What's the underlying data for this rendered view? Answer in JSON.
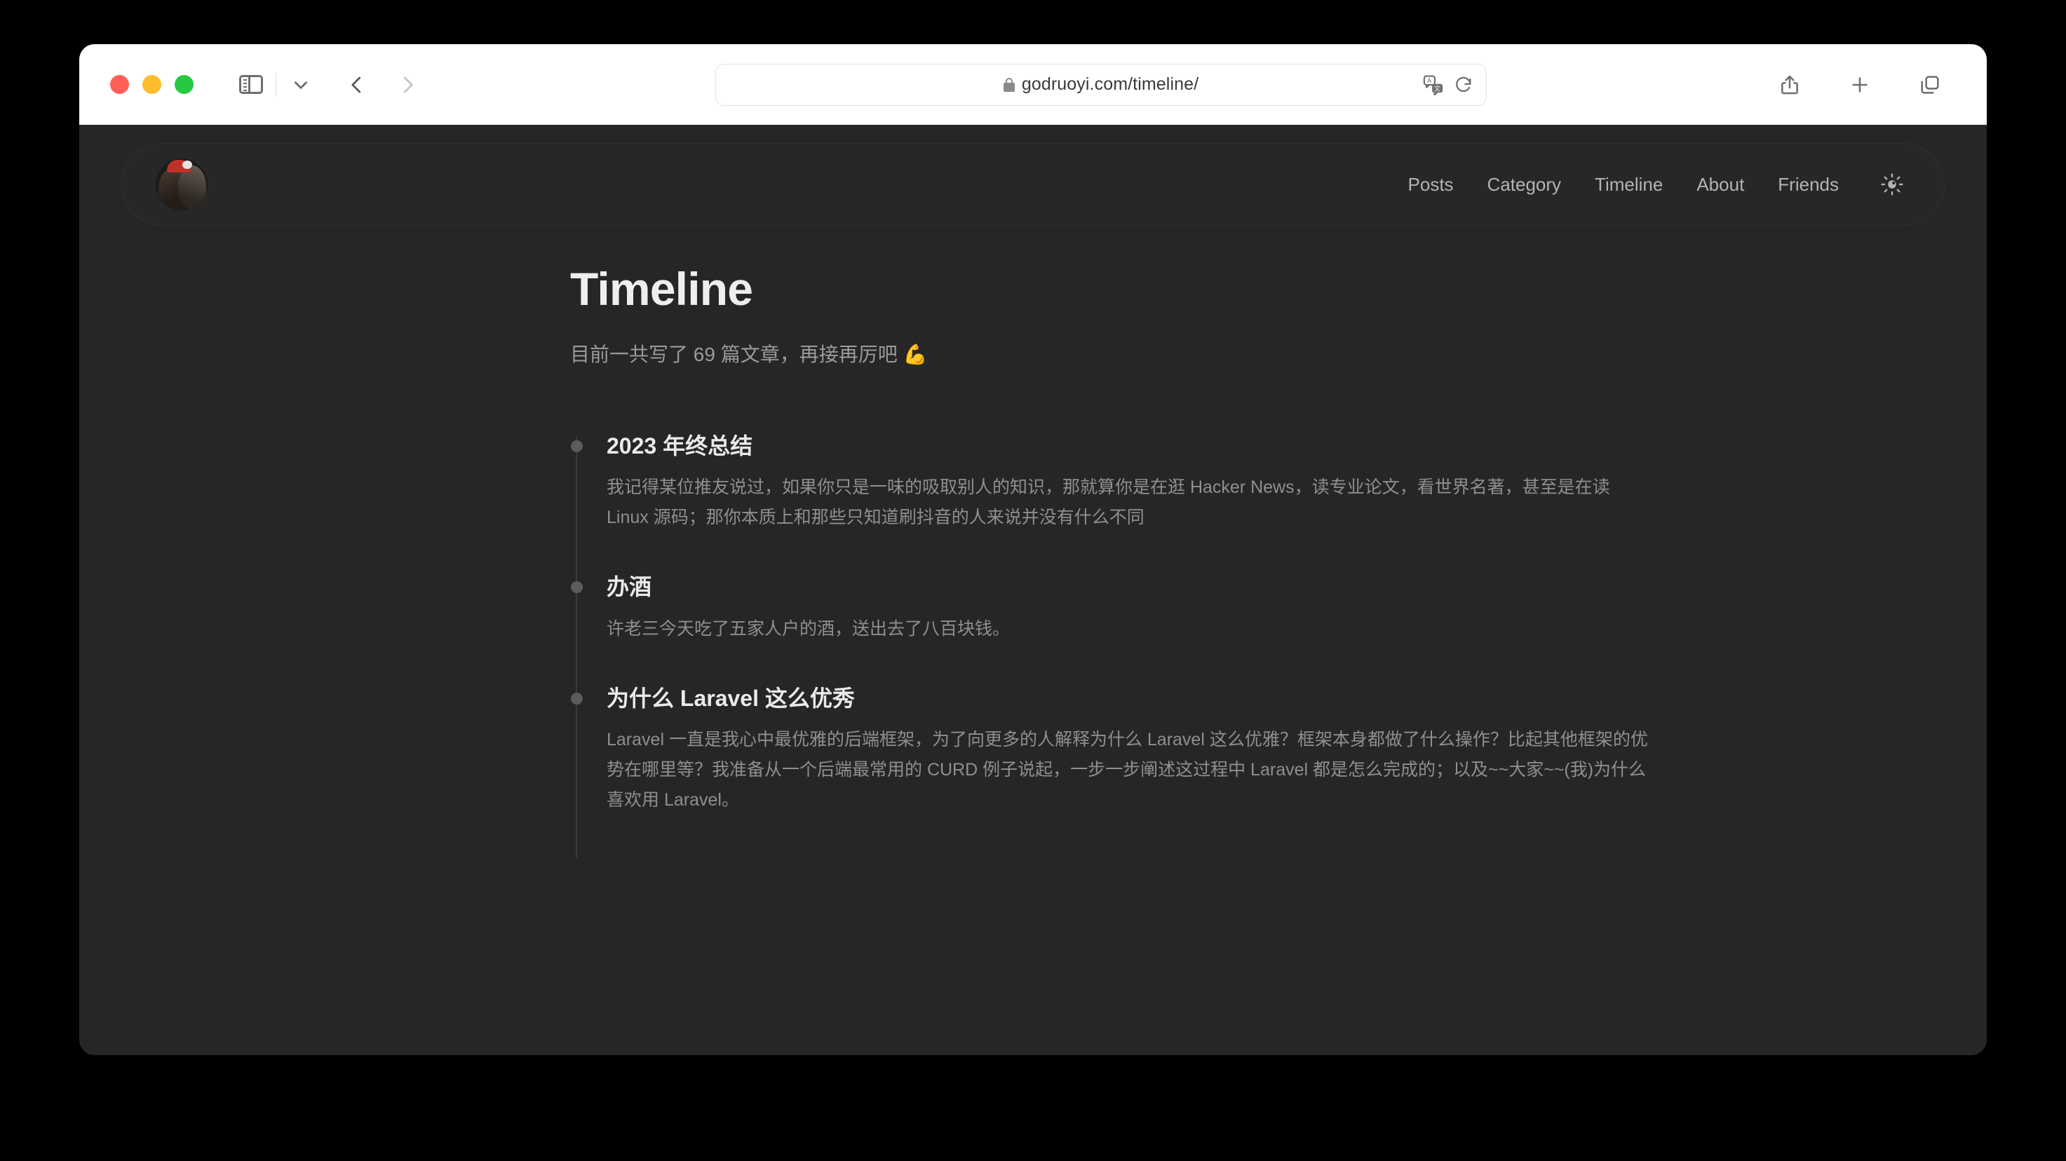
{
  "browser": {
    "traffic_lights": [
      "close",
      "minimize",
      "zoom"
    ],
    "sidebar_toggle_label": "Sidebar",
    "tab_group_chevron": "chevron-down",
    "back_label": "Back",
    "forward_label": "Forward",
    "url": "godruoyi.com/timeline/",
    "lock": "secure-lock",
    "translate_label": "Translate",
    "reload_label": "Reload",
    "share_label": "Share",
    "new_tab_label": "New Tab",
    "tab_overview_label": "Tab Overview"
  },
  "site": {
    "avatar_alt": "site avatar",
    "nav": [
      {
        "label": "Posts"
      },
      {
        "label": "Category"
      },
      {
        "label": "Timeline"
      },
      {
        "label": "About"
      },
      {
        "label": "Friends"
      }
    ],
    "theme_toggle": "sun-icon"
  },
  "main": {
    "title": "Timeline",
    "subtitle": "目前一共写了 69 篇文章，再接再厉吧 💪",
    "post_count": 69,
    "entries": [
      {
        "title": "2023 年终总结",
        "desc": "我记得某位推友说过，如果你只是一味的吸取别人的知识，那就算你是在逛 Hacker News，读专业论文，看世界名著，甚至是在读 Linux 源码；那你本质上和那些只知道刷抖音的人来说并没有什么不同"
      },
      {
        "title": "办酒",
        "desc": "许老三今天吃了五家人户的酒，送出去了八百块钱。"
      },
      {
        "title": "为什么 Laravel 这么优秀",
        "desc": "Laravel 一直是我心中最优雅的后端框架，为了向更多的人解释为什么 Laravel 这么优雅？框架本身都做了什么操作？比起其他框架的优势在哪里等？我准备从一个后端最常用的 CURD 例子说起，一步一步阐述这过程中 Laravel 都是怎么完成的；以及~~大家~~(我)为什么喜欢用 Laravel。"
      }
    ]
  },
  "colors": {
    "page_bg": "#262626",
    "header_bg": "#272727",
    "title": "#eeeeee",
    "body_text": "#8f8f8f",
    "dot": "#5c5c5c",
    "axis": "#3b3b3b",
    "toolbar_bg": "#ffffff"
  }
}
